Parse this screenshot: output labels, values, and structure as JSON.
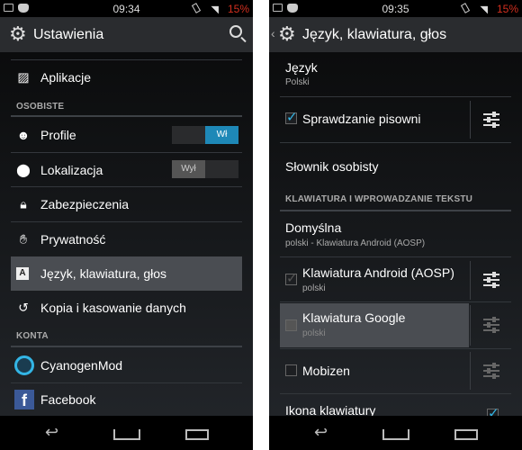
{
  "left": {
    "status": {
      "time": "09:34",
      "battery": "15%"
    },
    "title": "Ustawienia",
    "items": [
      {
        "label": "Aplikacje",
        "icon": "apps-icon"
      },
      {
        "label": "Profile",
        "icon": "profile-icon",
        "toggle": "Wł",
        "toggle_on": true
      },
      {
        "label": "Lokalizacja",
        "icon": "location-icon",
        "toggle": "Wył",
        "toggle_on": false
      },
      {
        "label": "Zabezpieczenia",
        "icon": "lock-icon"
      },
      {
        "label": "Prywatność",
        "icon": "privacy-icon"
      },
      {
        "label": "Język, klawiatura, głos",
        "icon": "language-icon",
        "selected": true
      },
      {
        "label": "Kopia i kasowanie danych",
        "icon": "backup-icon"
      },
      {
        "label": "CyanogenMod",
        "icon": "cyanogenmod-icon"
      },
      {
        "label": "Facebook",
        "icon": "facebook-icon"
      }
    ],
    "headers": [
      "OSOBISTE",
      "KONTA"
    ]
  },
  "right": {
    "status": {
      "time": "09:35",
      "battery": "15%"
    },
    "title": "Język, klawiatura, głos",
    "language": {
      "title": "Język",
      "summary": "Polski"
    },
    "spellcheck": {
      "title": "Sprawdzanie pisowni",
      "checked": true
    },
    "dictionary": "Słownik osobisty",
    "header": "KLAWIATURA I WPROWADZANIE TEKSTU",
    "default": {
      "title": "Domyślna",
      "summary": "polski - Klawiatura Android (AOSP)"
    },
    "keyboards": [
      {
        "title": "Klawiatura Android (AOSP)",
        "summary": "polski",
        "checked": true,
        "enabled": false
      },
      {
        "title": "Klawiatura Google",
        "summary": "polski",
        "checked": false,
        "selected": true
      },
      {
        "title": "Mobizen",
        "checked": false
      }
    ],
    "keyboard_icon": "Ikona klawiatury"
  },
  "colors": {
    "accent": "#33b5e5",
    "battery": "#d32f1f",
    "facebook": "#3b5998"
  }
}
